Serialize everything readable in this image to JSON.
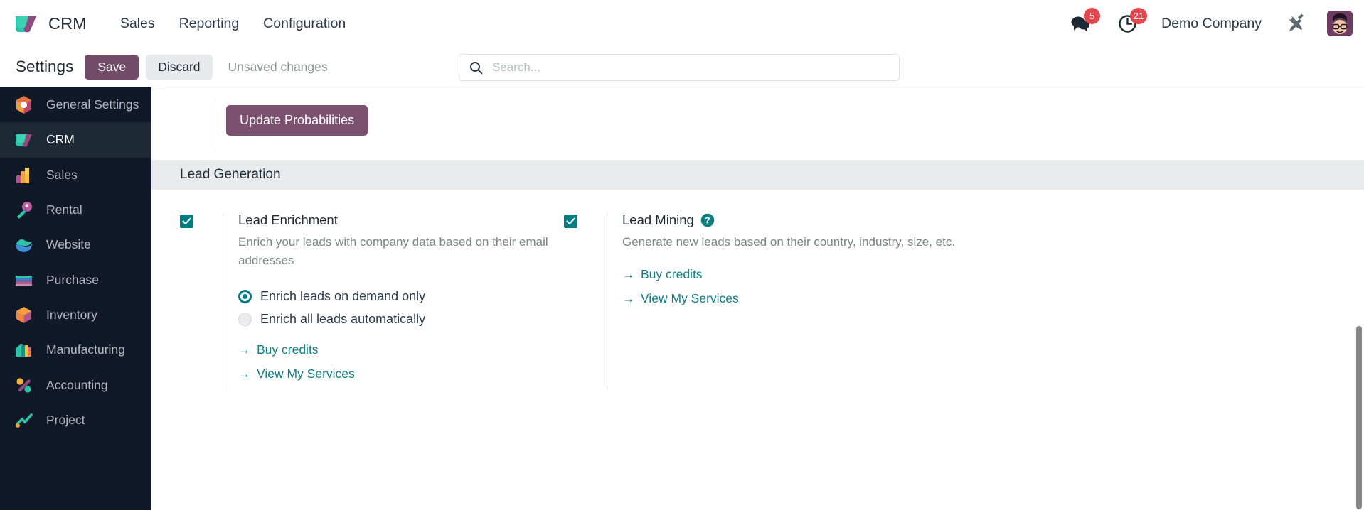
{
  "navbar": {
    "brand": "CRM",
    "brand_logo_icon": "odoo-crm-logo-icon",
    "menu": [
      {
        "label": "Sales"
      },
      {
        "label": "Reporting"
      },
      {
        "label": "Configuration"
      }
    ],
    "systray": {
      "messages_icon": "chat-bubbles-icon",
      "messages_count": "5",
      "activities_icon": "clock-icon",
      "activities_count": "21",
      "company": "Demo Company",
      "tools_icon": "wrench-screwdriver-icon",
      "avatar_icon": "user-avatar"
    }
  },
  "control_panel": {
    "title": "Settings",
    "save_label": "Save",
    "discard_label": "Discard",
    "status_text": "Unsaved changes"
  },
  "search": {
    "icon": "search-icon",
    "placeholder": "Search...",
    "value": ""
  },
  "sidebar": {
    "items": [
      {
        "label": "General Settings",
        "icon": "settings-gear-icon",
        "active": false
      },
      {
        "label": "CRM",
        "icon": "crm-icon",
        "active": true
      },
      {
        "label": "Sales",
        "icon": "sales-chart-icon",
        "active": false
      },
      {
        "label": "Rental",
        "icon": "rental-key-icon",
        "active": false
      },
      {
        "label": "Website",
        "icon": "website-globe-icon",
        "active": false
      },
      {
        "label": "Purchase",
        "icon": "purchase-card-icon",
        "active": false
      },
      {
        "label": "Inventory",
        "icon": "inventory-box-icon",
        "active": false
      },
      {
        "label": "Manufacturing",
        "icon": "manufacturing-icon",
        "active": false
      },
      {
        "label": "Accounting",
        "icon": "accounting-percent-icon",
        "active": false
      },
      {
        "label": "Project",
        "icon": "project-icon",
        "active": false
      }
    ]
  },
  "main": {
    "update_probabilities_label": "Update Probabilities",
    "section": {
      "title": "Lead Generation"
    },
    "lead_enrichment": {
      "checked": true,
      "title": "Lead Enrichment",
      "description": "Enrich your leads with company data based on their email addresses",
      "radios": [
        {
          "label": "Enrich leads on demand only",
          "selected": true
        },
        {
          "label": "Enrich all leads automatically",
          "selected": false
        }
      ],
      "links": [
        {
          "label": "Buy credits",
          "arrow": "→"
        },
        {
          "label": "View My Services",
          "arrow": "→"
        }
      ]
    },
    "lead_mining": {
      "checked": true,
      "title": "Lead Mining",
      "help_icon": "question-mark-help-icon",
      "description": "Generate new leads based on their country, industry, size, etc.",
      "links": [
        {
          "label": "Buy credits",
          "arrow": "→"
        },
        {
          "label": "View My Services",
          "arrow": "→"
        }
      ]
    }
  },
  "colors": {
    "brand_purple": "#714b67",
    "accent_teal": "#017e84",
    "link_teal": "#0d7f83",
    "sidebar_bg": "#111827",
    "badge_red": "#e2474e",
    "section_bg": "#e9eaec"
  }
}
